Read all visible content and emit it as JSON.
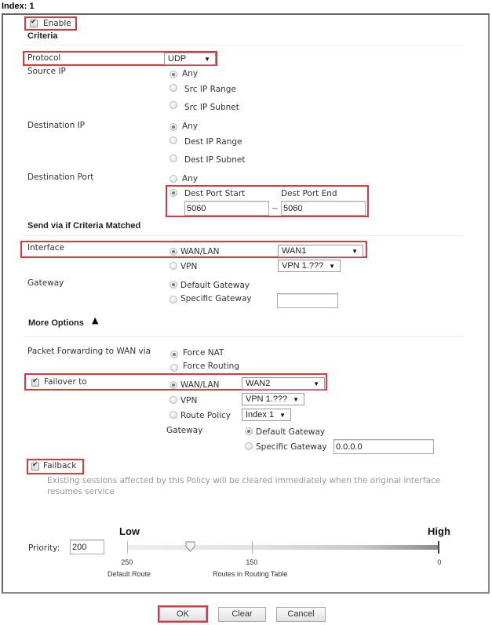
{
  "title": "Index: 1",
  "enable": {
    "label": "Enable",
    "checked": true
  },
  "criteria": {
    "heading": "Criteria",
    "protocol": {
      "label": "Protocol",
      "value": "UDP"
    },
    "source_ip": {
      "label": "Source IP",
      "options": [
        "Any",
        "Src IP Range",
        "Src IP Subnet"
      ],
      "selected": "Any"
    },
    "destination_ip": {
      "label": "Destination IP",
      "options": [
        "Any",
        "Dest IP Range",
        "Dest IP Subnet"
      ],
      "selected": "Any"
    },
    "destination_port": {
      "label": "Destination Port",
      "options": [
        "Any",
        "Dest Port Start"
      ],
      "selected": "Dest Port Start",
      "start_label": "Dest Port Start",
      "end_label": "Dest Port End",
      "start_value": "5060",
      "end_value": "5060",
      "separator": "~"
    }
  },
  "send_via": {
    "heading": "Send via if Criteria Matched",
    "interface": {
      "label": "Interface",
      "wan_label": "WAN/LAN",
      "wan_value": "WAN1",
      "vpn_label": "VPN",
      "vpn_value": "VPN 1.???",
      "selected": "WAN/LAN"
    },
    "gateway": {
      "label": "Gateway",
      "default_label": "Default Gateway",
      "specific_label": "Specific Gateway",
      "specific_value": "",
      "selected": "Default Gateway"
    }
  },
  "more_options": {
    "heading": "More Options",
    "toggle_icon": "collapse-arrow-up",
    "packet_forwarding": {
      "label": "Packet Forwarding to WAN via",
      "options": [
        "Force NAT",
        "Force Routing"
      ],
      "selected": "Force NAT"
    },
    "failover": {
      "label": "Failover to",
      "checked": true,
      "wan_label": "WAN/LAN",
      "wan_value": "WAN2",
      "vpn_label": "VPN",
      "vpn_value": "VPN 1.???",
      "route_policy_label": "Route Policy",
      "route_policy_value": "Index 1",
      "selected": "WAN/LAN",
      "gateway_label": "Gateway",
      "default_label": "Default Gateway",
      "specific_label": "Specific Gateway",
      "specific_value": "0.0.0.0",
      "gateway_selected": "Default Gateway"
    },
    "failback": {
      "label": "Failback",
      "checked": true,
      "note": "Existing sessions affected by this Policy will be cleared immediately when the original interface resumes service"
    }
  },
  "priority": {
    "label": "Priority:",
    "value": "200",
    "low_label": "Low",
    "high_label": "High",
    "ticks": [
      {
        "value": "250",
        "caption": "Default Route"
      },
      {
        "value": "150",
        "caption": "Routes in Routing Table"
      },
      {
        "value": "0",
        "caption": ""
      }
    ],
    "slider_value": 200,
    "slider_min": 250,
    "slider_max": 0
  },
  "buttons": {
    "ok": "OK",
    "clear": "Clear",
    "cancel": "Cancel"
  },
  "colors": {
    "highlight": "#e0373f"
  }
}
